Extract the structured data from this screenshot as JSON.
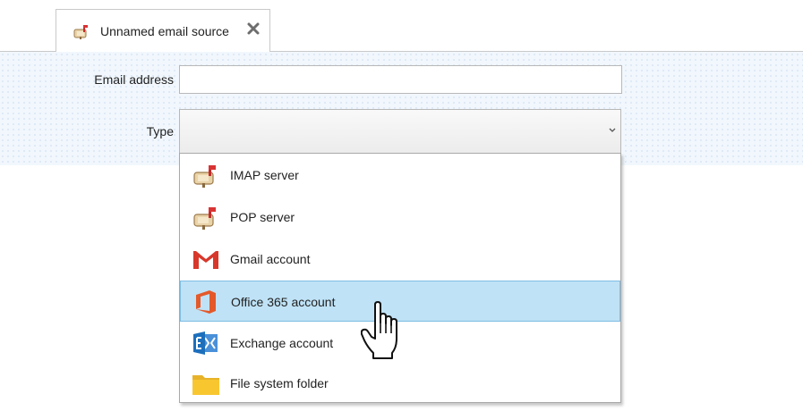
{
  "tab": {
    "title": "Unnamed email source",
    "icon": "mailbox-icon",
    "close_icon": "close-icon"
  },
  "form": {
    "email_label": "Email address",
    "email_value": "",
    "type_label": "Type",
    "type_selected": ""
  },
  "dropdown": {
    "items": [
      {
        "label": "IMAP server",
        "icon": "mailbox-icon"
      },
      {
        "label": "POP server",
        "icon": "mailbox-icon"
      },
      {
        "label": "Gmail account",
        "icon": "gmail-icon"
      },
      {
        "label": "Office 365 account",
        "icon": "office365-icon",
        "highlighted": true
      },
      {
        "label": "Exchange account",
        "icon": "exchange-icon"
      },
      {
        "label": "File system folder",
        "icon": "folder-icon"
      }
    ]
  },
  "colors": {
    "form_background": "#f1f7fd",
    "highlight": "#bfe2f6",
    "office_orange": "#e4592a",
    "gmail_red": "#d8382b",
    "exchange_blue": "#1d6fbc",
    "folder_yellow": "#f8c730"
  }
}
